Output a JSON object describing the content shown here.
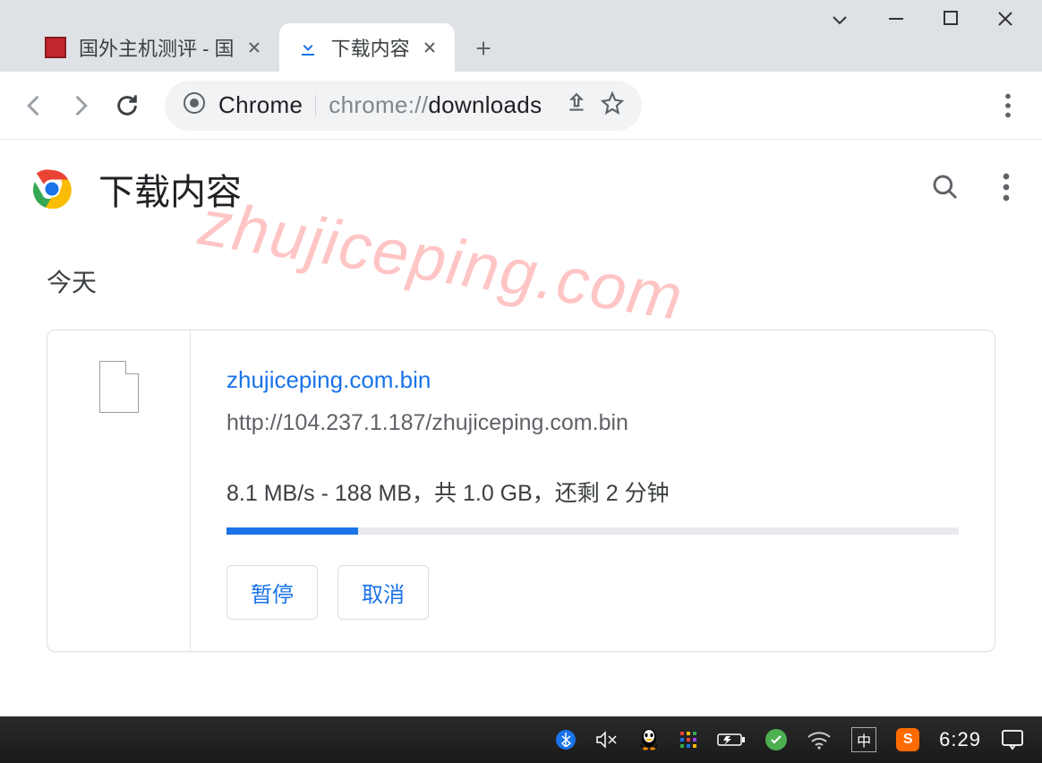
{
  "tabs": {
    "inactive": {
      "title": "国外主机测评 - 国"
    },
    "active": {
      "title": "下载内容"
    }
  },
  "omnibox": {
    "scheme_label": "Chrome",
    "url_grey": "chrome://",
    "url_bold": "downloads"
  },
  "page": {
    "title": "下载内容",
    "section": "今天"
  },
  "download": {
    "filename": "zhujiceping.com.bin",
    "url": "http://104.237.1.187/zhujiceping.com.bin",
    "status": "8.1 MB/s - 188 MB，共 1.0 GB，还剩 2 分钟",
    "progress_percent": 18,
    "pause_label": "暂停",
    "cancel_label": "取消"
  },
  "watermark": "zhujiceping.com",
  "taskbar": {
    "ime": "中",
    "sogou": "S",
    "clock": "6:29"
  }
}
